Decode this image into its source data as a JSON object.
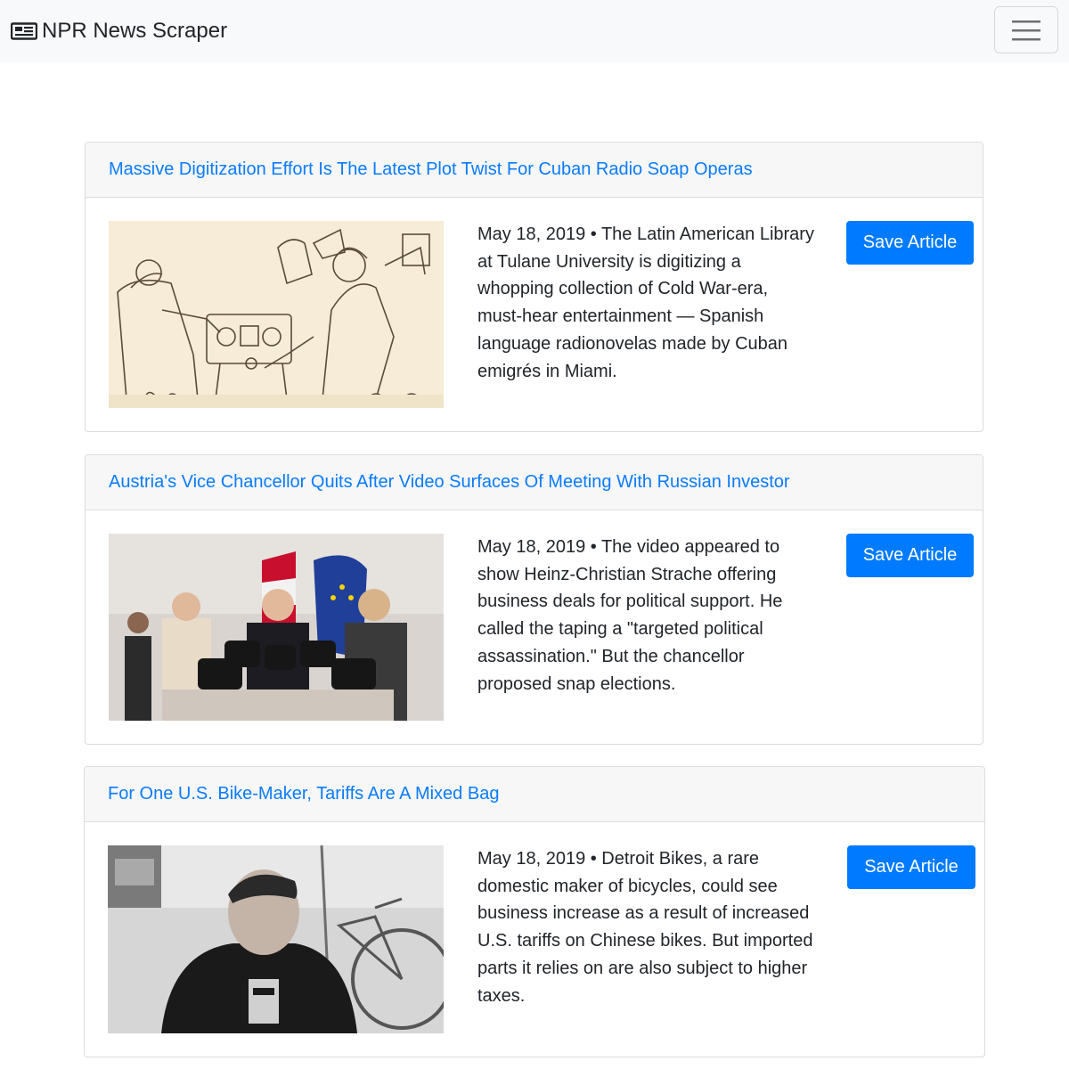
{
  "navbar": {
    "brand_icon": "newspaper-icon",
    "brand_label": "NPR News Scraper",
    "toggler_icon": "hamburger-menu-icon"
  },
  "articles": [
    {
      "title": "Massive Digitization Effort Is The Latest Plot Twist For Cuban Radio Soap Operas",
      "summary": "May 18, 2019 • The Latin American Library at Tulane University is digitizing a whopping collection of Cold War-era, must-hear entertainment — Spanish language radionovelas made by Cuban emigrés in Miami.",
      "save_label": "Save Article"
    },
    {
      "title": "Austria's Vice Chancellor Quits After Video Surfaces Of Meeting With Russian Investor",
      "summary": "May 18, 2019 • The video appeared to show Heinz-Christian Strache offering business deals for political support. He called the taping a \"targeted political assassination.\" But the chancellor proposed snap elections.",
      "save_label": "Save Article"
    },
    {
      "title": "For One U.S. Bike-Maker, Tariffs Are A Mixed Bag",
      "summary": "May 18, 2019 • Detroit Bikes, a rare domestic maker of bicycles, could see business increase as a result of increased U.S. tariffs on Chinese bikes. But imported parts it relies on are also subject to higher taxes.",
      "save_label": "Save Article"
    }
  ]
}
